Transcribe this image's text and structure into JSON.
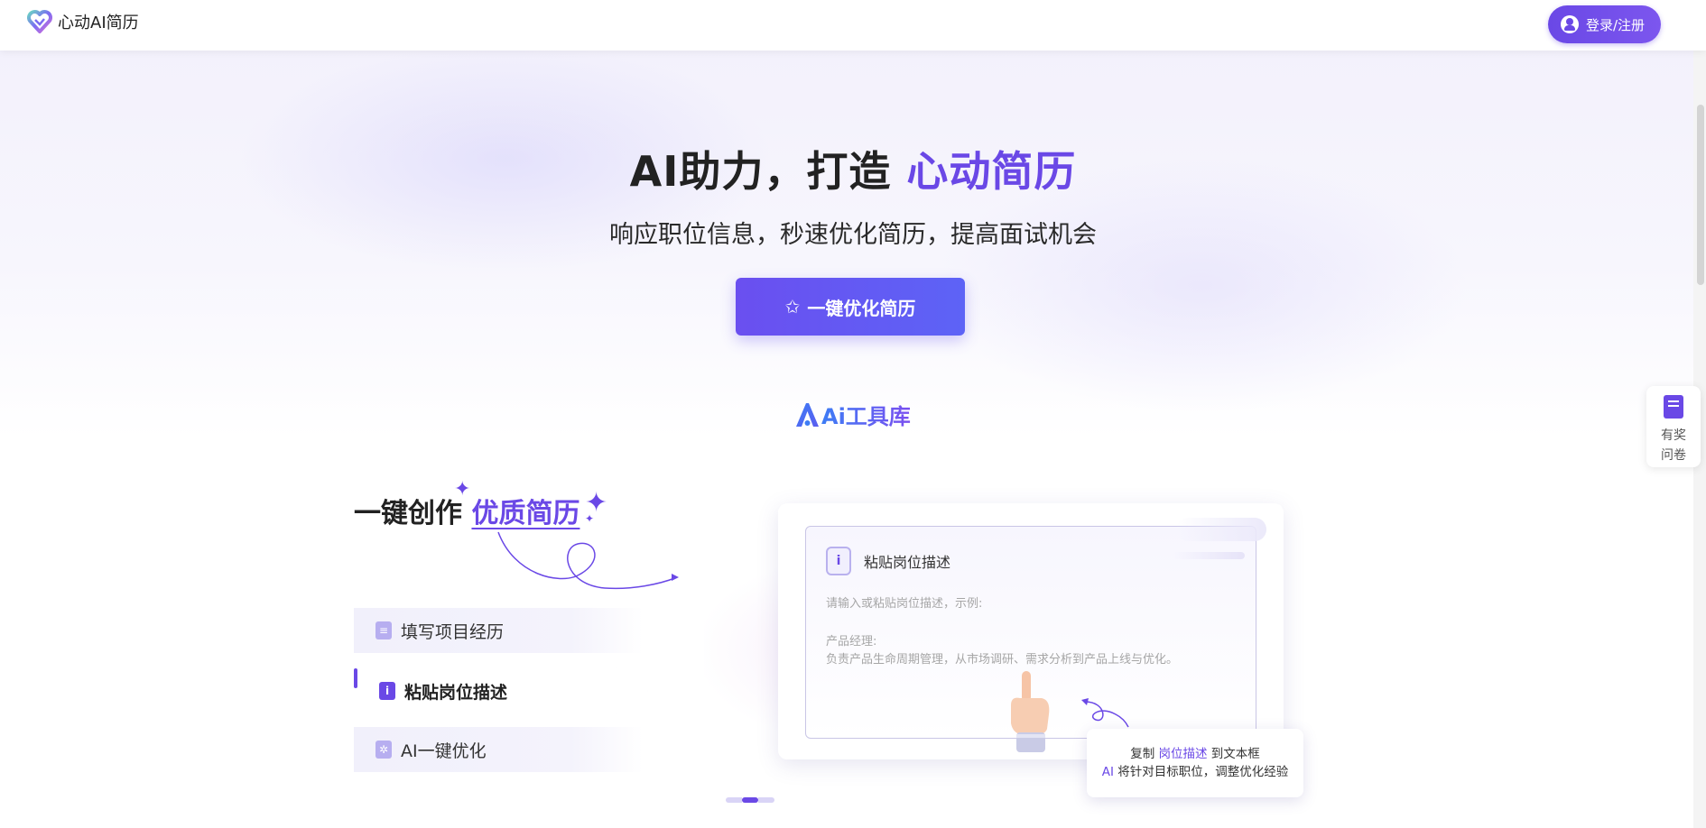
{
  "header": {
    "logo_text": "心动AI简历",
    "login_label": "登录/注册"
  },
  "hero": {
    "title_main": "AI助力，打造 ",
    "title_accent": "心动简历",
    "subtitle": "响应职位信息，秒速优化简历，提高面试机会",
    "cta_label": "一键优化简历"
  },
  "tool_lib": {
    "label": "Ai工具库"
  },
  "features": {
    "title_main": "一键创作 ",
    "title_accent": "优质简历",
    "items": [
      {
        "label": "填写项目经历",
        "icon": "document-icon"
      },
      {
        "label": "粘贴岗位描述",
        "icon": "info-icon"
      },
      {
        "label": "AI一键优化",
        "icon": "sparkle-icon"
      }
    ],
    "active_index": 1
  },
  "card": {
    "title": "粘贴岗位描述",
    "placeholder": "请输入或粘贴岗位描述，示例:",
    "example_title": "产品经理:",
    "example_body": "负责产品生命周期管理，从市场调研、需求分析到产品上线与优化。"
  },
  "tip": {
    "line1_pre": "复制 ",
    "line1_hl": "岗位描述",
    "line1_post": " 到文本框",
    "line2_hl": "AI",
    "line2_post": " 将针对目标职位，调整优化经验"
  },
  "carousel": {
    "count": 3,
    "active": 1
  },
  "survey": {
    "label": "有奖问卷"
  },
  "colors": {
    "accent": "#6a48e6",
    "accent_blue": "#3d7cf5"
  }
}
